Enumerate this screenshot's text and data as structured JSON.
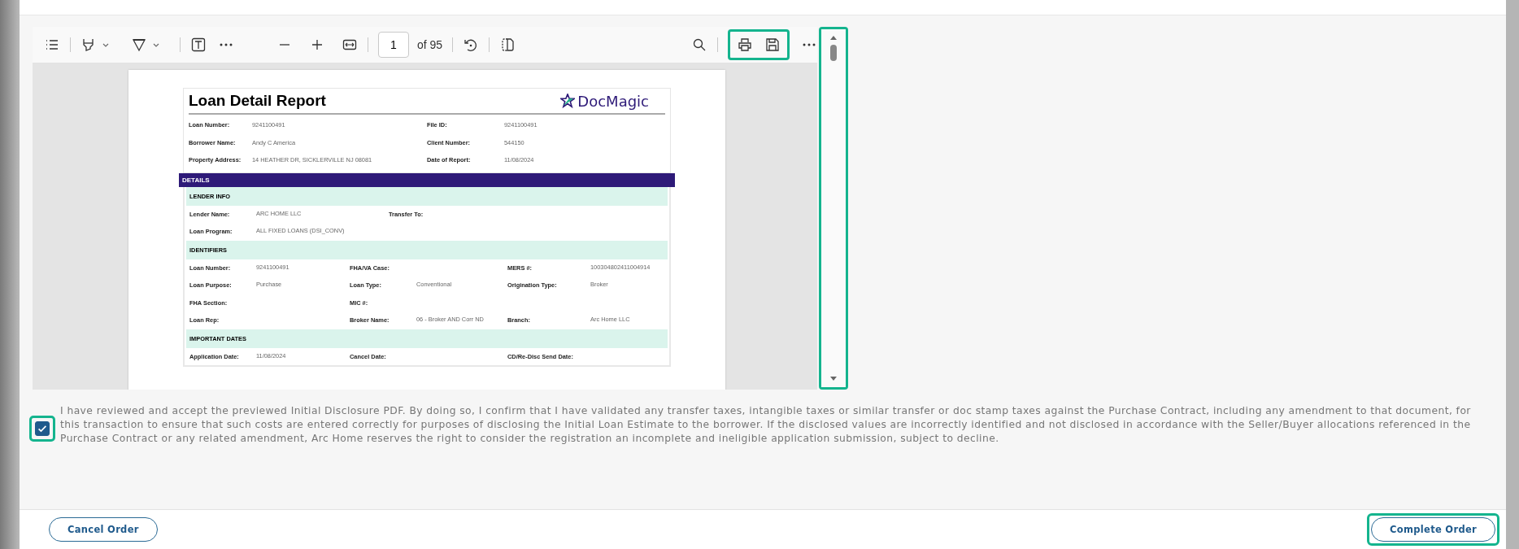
{
  "toolbar": {
    "page_number": "1",
    "page_count": "of 95",
    "highlighted_group": true
  },
  "report": {
    "title": "Loan Detail Report",
    "logo_text": "DocMagic",
    "header_fields": [
      {
        "label": "Loan Number:",
        "value": "9241100491"
      },
      {
        "label": "File ID:",
        "value": "9241100491"
      },
      {
        "label": "Borrower Name:",
        "value": "Andy C America"
      },
      {
        "label": "Client Number:",
        "value": "544150"
      },
      {
        "label": "Property Address:",
        "value": "14 HEATHER DR, SICKLERVILLE NJ 08081"
      },
      {
        "label": "Date of Report:",
        "value": "11/08/2024"
      }
    ],
    "band": "DETAILS",
    "sections": [
      {
        "title": "LENDER INFO",
        "rows": [
          [
            {
              "label": "Lender Name:",
              "value": "ARC HOME LLC"
            },
            {
              "label": "Transfer To:"
            }
          ],
          [
            {
              "label": "Loan Program:",
              "value": "ALL FIXED LOANS (DSI_CONV)"
            }
          ]
        ]
      },
      {
        "title": "IDENTIFIERS",
        "rows": [
          [
            {
              "label": "Loan Number:",
              "value": "9241100491"
            },
            {
              "label": "FHA/VA Case:"
            },
            {
              "label": "MERS #:",
              "value": "100304802411004914"
            }
          ],
          [
            {
              "label": "Loan Purpose:",
              "value": "Purchase"
            },
            {
              "label": "Loan Type:",
              "value": "Conventional"
            },
            {
              "label": "Origination Type:",
              "value": "Broker"
            }
          ],
          [
            {
              "label": "FHA Section:"
            },
            {
              "label": "MIC #:"
            }
          ],
          [
            {
              "label": "Loan Rep:"
            },
            {
              "label": "Broker Name:",
              "value": "06 - Broker AND Corr ND"
            },
            {
              "label": "Branch:",
              "value": "Arc Home LLC"
            }
          ]
        ]
      },
      {
        "title": "IMPORTANT DATES",
        "rows": [
          [
            {
              "label": "Application Date:",
              "value": "11/08/2024"
            },
            {
              "label": "Cancel Date:"
            },
            {
              "label": "CD/Re-Disc Send Date:"
            }
          ]
        ]
      }
    ]
  },
  "agreement": {
    "checked": true,
    "highlighted": true,
    "text": "I have reviewed and accept the previewed Initial Disclosure PDF. By doing so, I confirm that I have validated any transfer taxes, intangible taxes or similar transfer or doc stamp taxes against the Purchase Contract, including any amendment to that document, for this transaction to ensure that such costs are entered correctly for purposes of disclosing the Initial Loan Estimate to the borrower. If the disclosed values are incorrectly identified and not disclosed in accordance with the Seller/Buyer allocations referenced in the Purchase Contract or any related amendment, Arc Home reserves the right to consider the registration an incomplete and ineligible application submission, subject to decline."
  },
  "buttons": [
    {
      "label": "Cancel Order",
      "highlighted": false
    },
    {
      "label": "Complete Order",
      "highlighted": true
    }
  ]
}
